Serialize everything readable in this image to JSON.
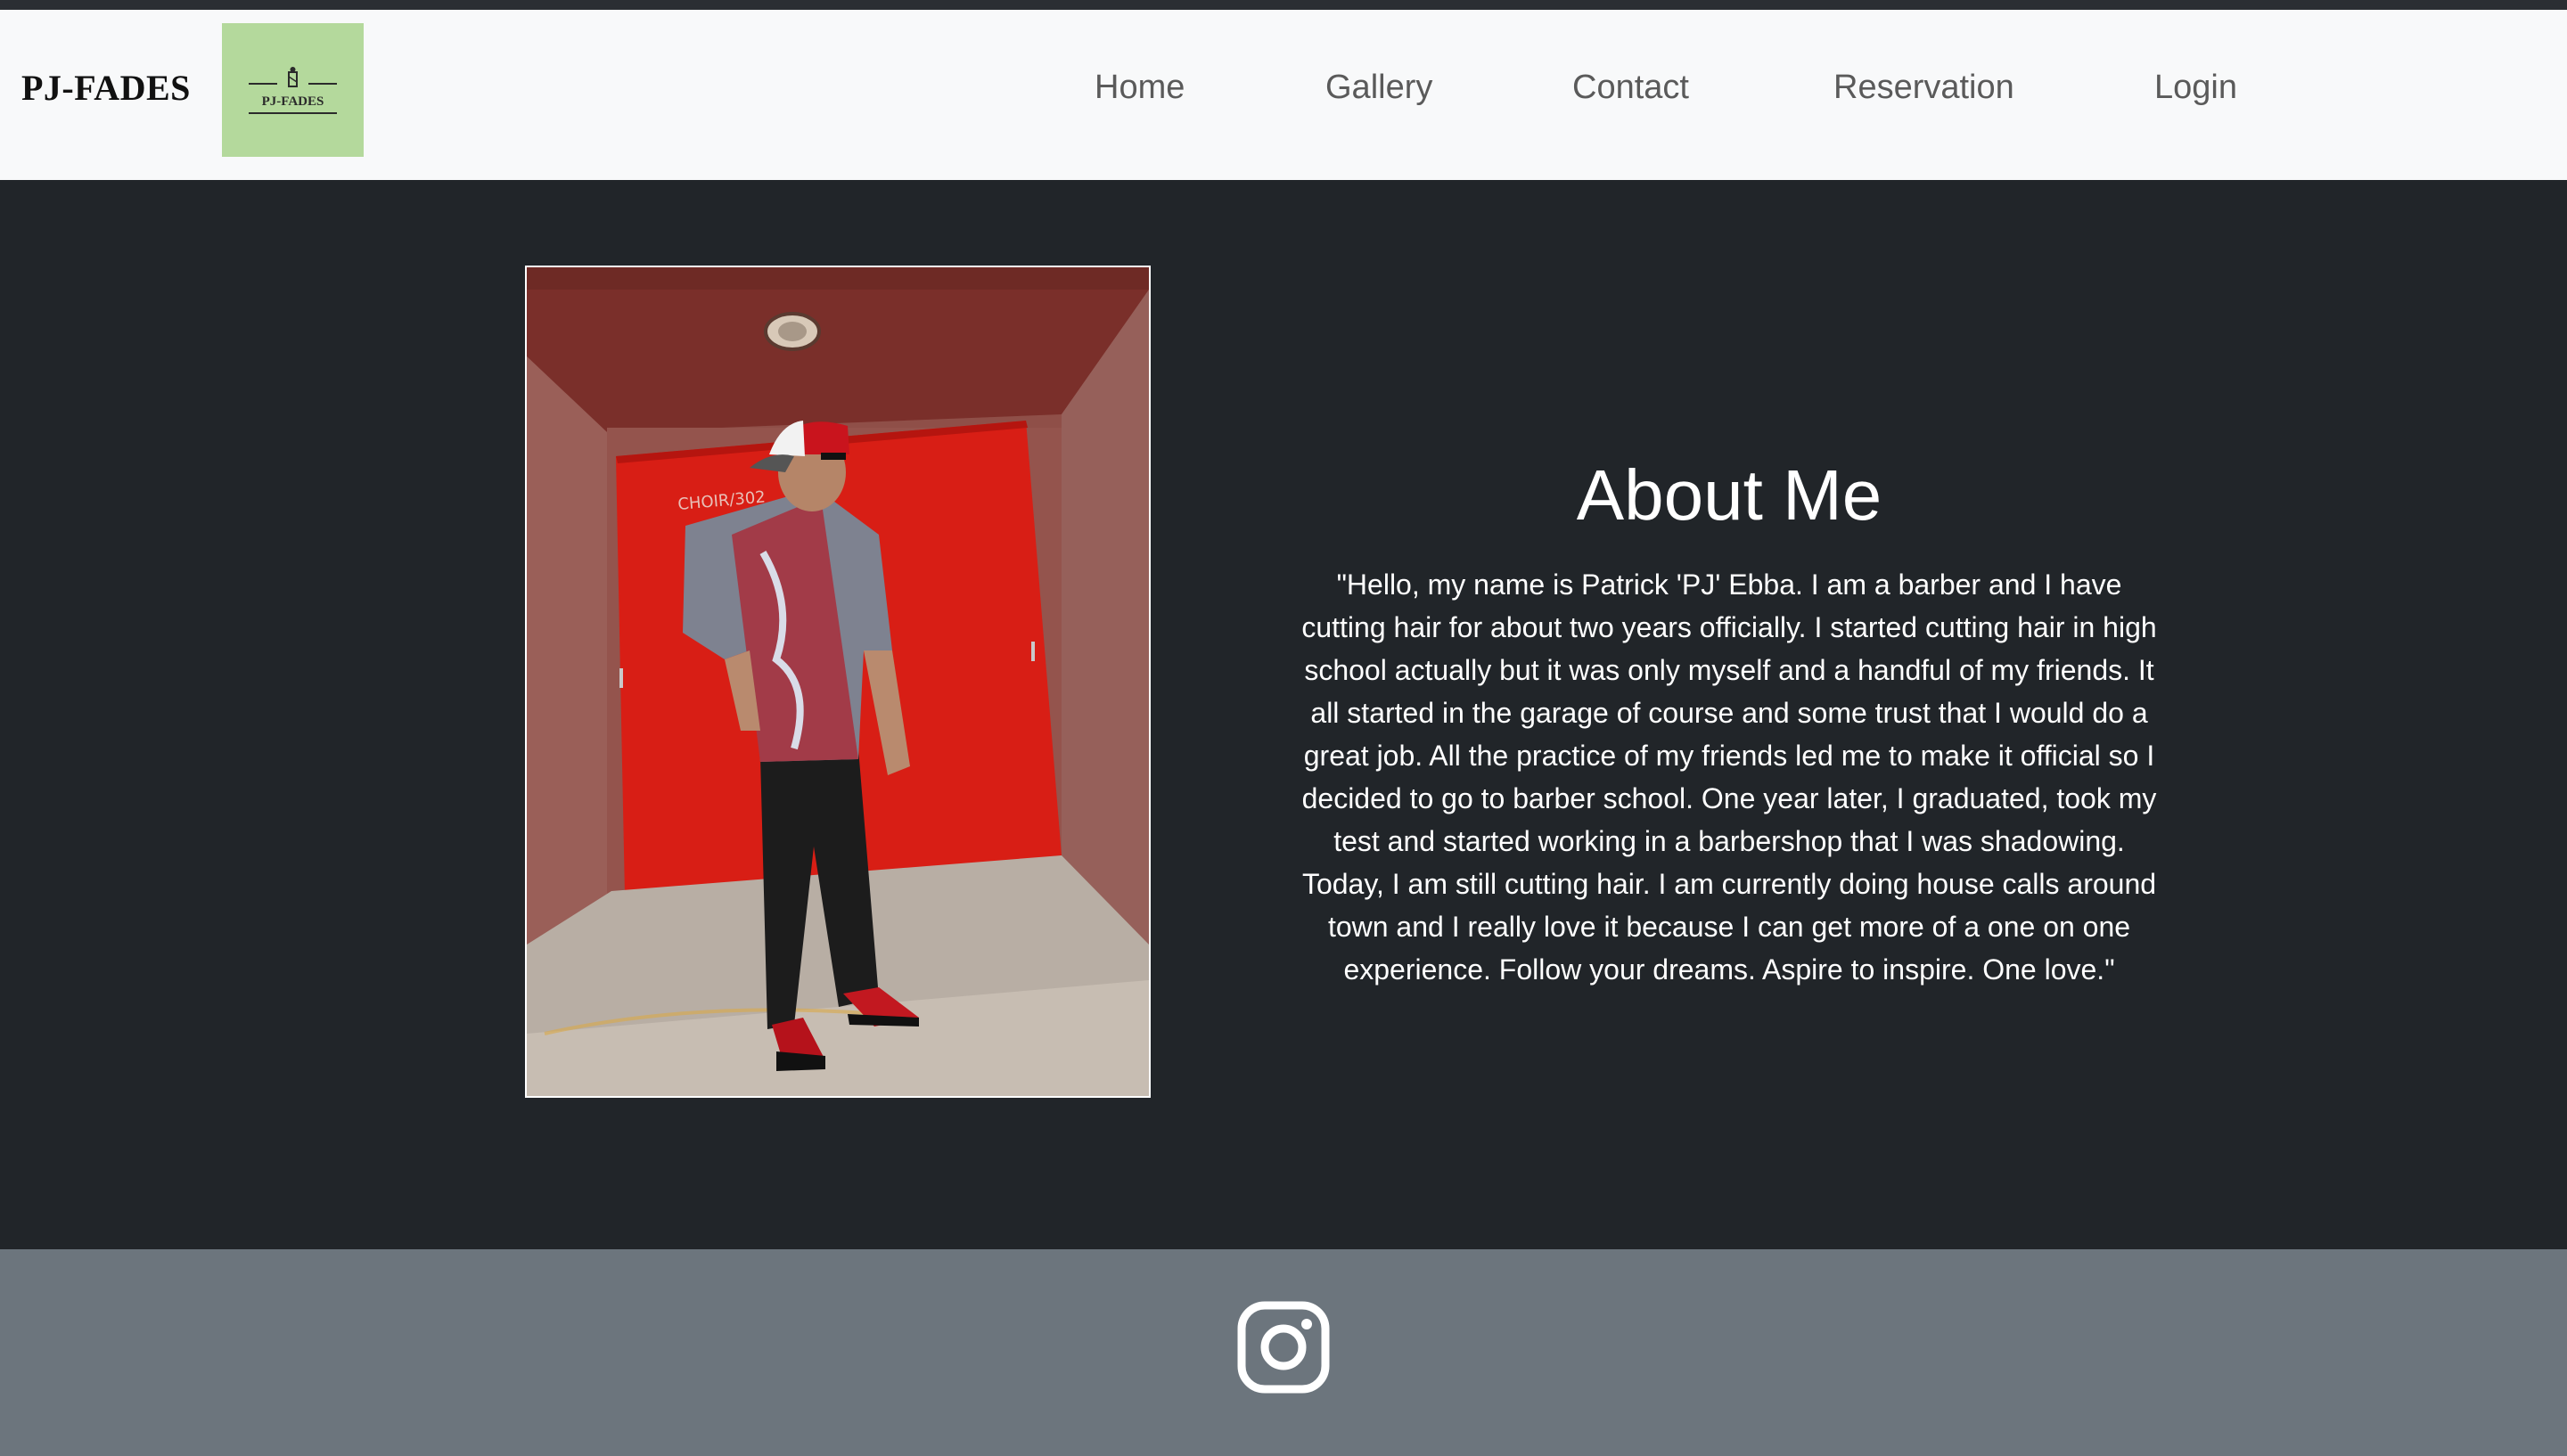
{
  "brand": {
    "name": "PJ-FADES",
    "logo_text": "PJ-FADES",
    "logo_bg": "#b4d99c"
  },
  "nav": {
    "items": [
      {
        "label": "Home"
      },
      {
        "label": "Gallery"
      },
      {
        "label": "Contact"
      },
      {
        "label": "Reservation"
      },
      {
        "label": "Login"
      }
    ]
  },
  "about": {
    "title": "About Me",
    "paragraph": "\"Hello, my name is Patrick 'PJ' Ebba. I am a barber and I have cutting hair for about two years officially. I started cutting hair in high school actually but it was only myself and a handful of my friends. It all started in the garage of course and some trust that I would do a great job. All the practice of my friends led me to make it official so I decided to go to barber school. One year later, I graduated, took my test and started working in a barbershop that I was shadowing. Today, I am still cutting hair. I am currently doing house calls around town and I really love it because I can get more of a one on one experience. Follow your dreams. Aspire to inspire. One love.\"",
    "photo_door_sign": "CHOIR/302"
  },
  "footer": {
    "social_icon": "instagram-icon"
  },
  "colors": {
    "navbar_bg": "#f8f9fa",
    "main_bg": "#212529",
    "footer_bg": "#6c757d",
    "nav_text": "#5a5a5a"
  }
}
